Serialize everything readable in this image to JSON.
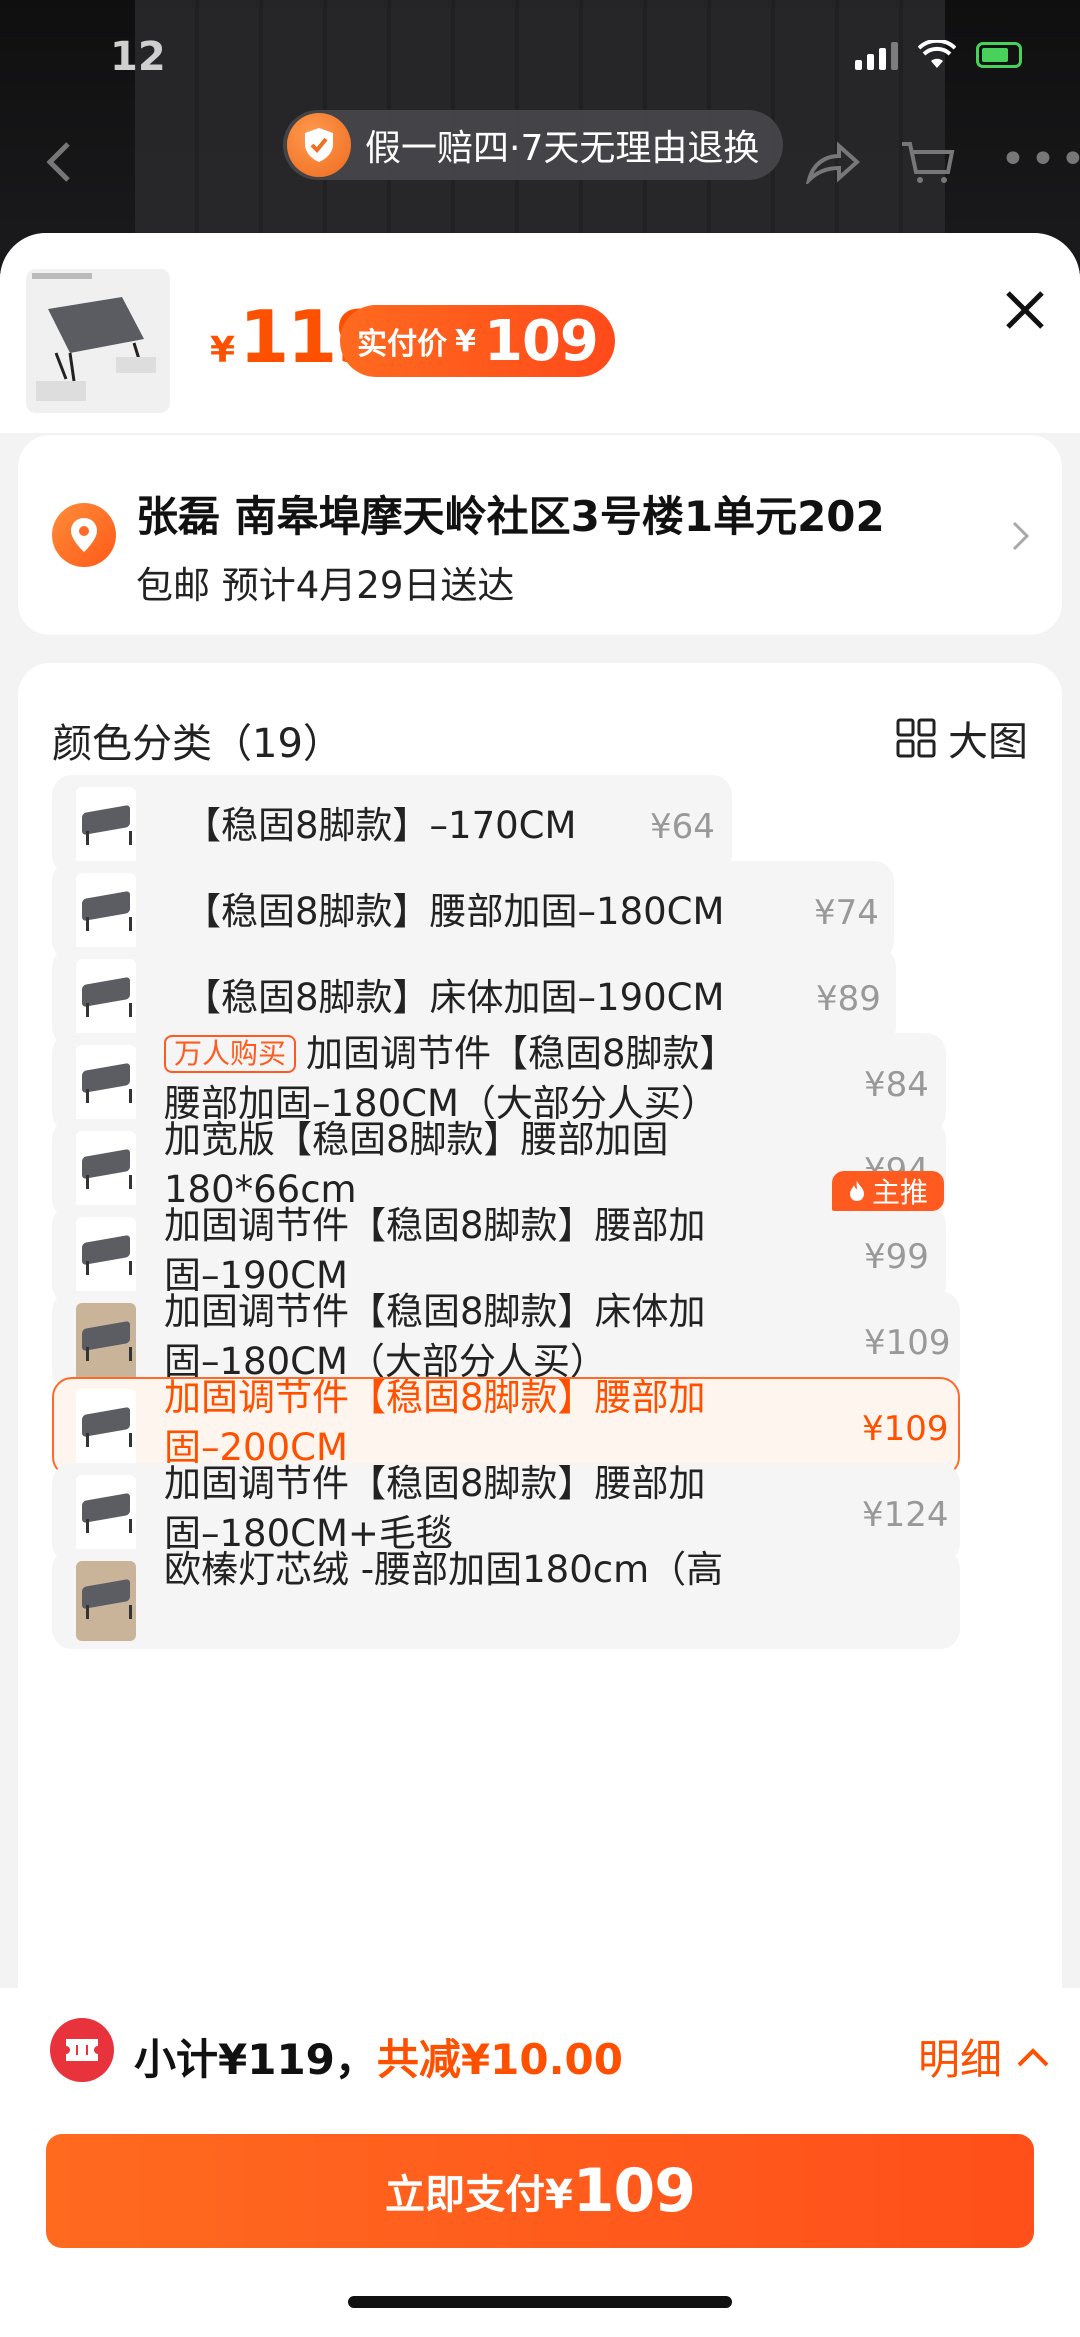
{
  "status_bar": {
    "time": "12"
  },
  "banner": {
    "text": "假一赔四·7天无理由退换"
  },
  "product": {
    "price_symbol": "¥",
    "price": "119",
    "pay_label": "实付价",
    "pay_symbol": "¥",
    "pay_amount": "109"
  },
  "address": {
    "line1": "张磊 南皋埠摩天岭社区3号楼1单元202",
    "line2": "包邮 预计4月29日送达"
  },
  "options_header": {
    "title": "颜色分类（19）",
    "big_view": "大图"
  },
  "options": [
    {
      "label": "【稳固8脚款】–170CM",
      "price": "¥64"
    },
    {
      "label": "【稳固8脚款】腰部加固–180CM",
      "price": "¥74"
    },
    {
      "label": "【稳固8脚款】床体加固–190CM",
      "price": "¥89"
    },
    {
      "tag": "万人购买",
      "badge": "主推",
      "line1": "加固调节件【稳固8脚款】",
      "line2": "腰部加固–180CM（大部分人买）",
      "price": "¥84"
    },
    {
      "line1": "加宽版【稳固8脚款】腰部加固",
      "line2": "180*66cm",
      "price": "¥94"
    },
    {
      "line1": "加固调节件【稳固8脚款】腰部加",
      "line2": "固–190CM",
      "price": "¥99"
    },
    {
      "line1": "加固调节件【稳固8脚款】床体加",
      "line2": "固–180CM（大部分人买）",
      "price": "¥109"
    },
    {
      "line1": "加固调节件【稳固8脚款】腰部加",
      "line2": "固–200CM",
      "price": "¥109",
      "selected": true
    },
    {
      "line1": "加固调节件【稳固8脚款】腰部加",
      "line2": "固–180CM+毛毯",
      "price": "¥124"
    },
    {
      "line1": "欧榛灯芯绒 -腰部加固180cm（高"
    }
  ],
  "summary": {
    "subtotal": "小计¥119，",
    "discount": "共减¥10.00",
    "detail": "明细"
  },
  "pay_button": {
    "label": "立即支付¥",
    "amount": "109"
  },
  "colors": {
    "accent": "#ff5000",
    "coupon": "#e8323c"
  }
}
